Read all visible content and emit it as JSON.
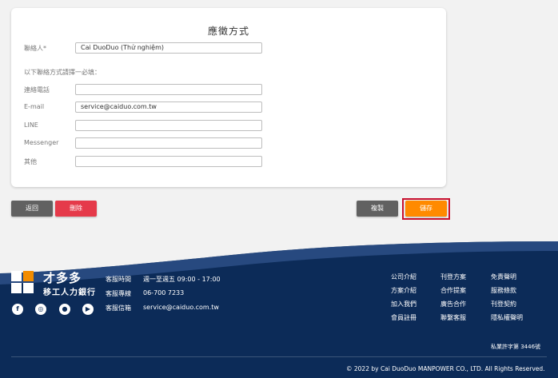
{
  "form": {
    "title": "應徵方式",
    "contact_label": "聯絡人*",
    "contact_value": "Cai DuoDuo (Thử nghiệm)",
    "hint": "以下聯絡方式請擇一必填：",
    "phone_label": "連絡電話",
    "phone_value": "",
    "email_label": "E-mail",
    "email_value": "service@caiduo.com.tw",
    "line_label": "LINE",
    "line_value": "",
    "messenger_label": "Messenger",
    "messenger_value": "",
    "other_label": "其他",
    "other_value": ""
  },
  "actions": {
    "back": "返回",
    "delete": "刪除",
    "copy": "複製",
    "save": "儲存"
  },
  "footer": {
    "logo_name": "才多多",
    "logo_sub": "移工人力銀行",
    "social": [
      "facebook-icon",
      "instagram-icon",
      "line-icon",
      "youtube-icon"
    ],
    "contact": {
      "hours_label": "客服時間",
      "hours_value": "週一至週五   09:00 - 17:00",
      "phone_label": "客服專線",
      "phone_value": "06-700 7233",
      "email_label": "客服信箱",
      "email_value": "service@caiduo.com.tw"
    },
    "links_col1": [
      "公司介紹",
      "方案介紹",
      "加入我們",
      "會員註冊"
    ],
    "links_col2": [
      "刊登方案",
      "合作提案",
      "廣告合作",
      "聯繫客服"
    ],
    "links_col3": [
      "免責聲明",
      "服務條款",
      "刊登契約",
      "隱私權聲明"
    ],
    "license": "私業許字第 3446號",
    "copyright": "© 2022 by Cai DuoDuo MANPOWER CO., LTD. All Rights Reserved."
  }
}
